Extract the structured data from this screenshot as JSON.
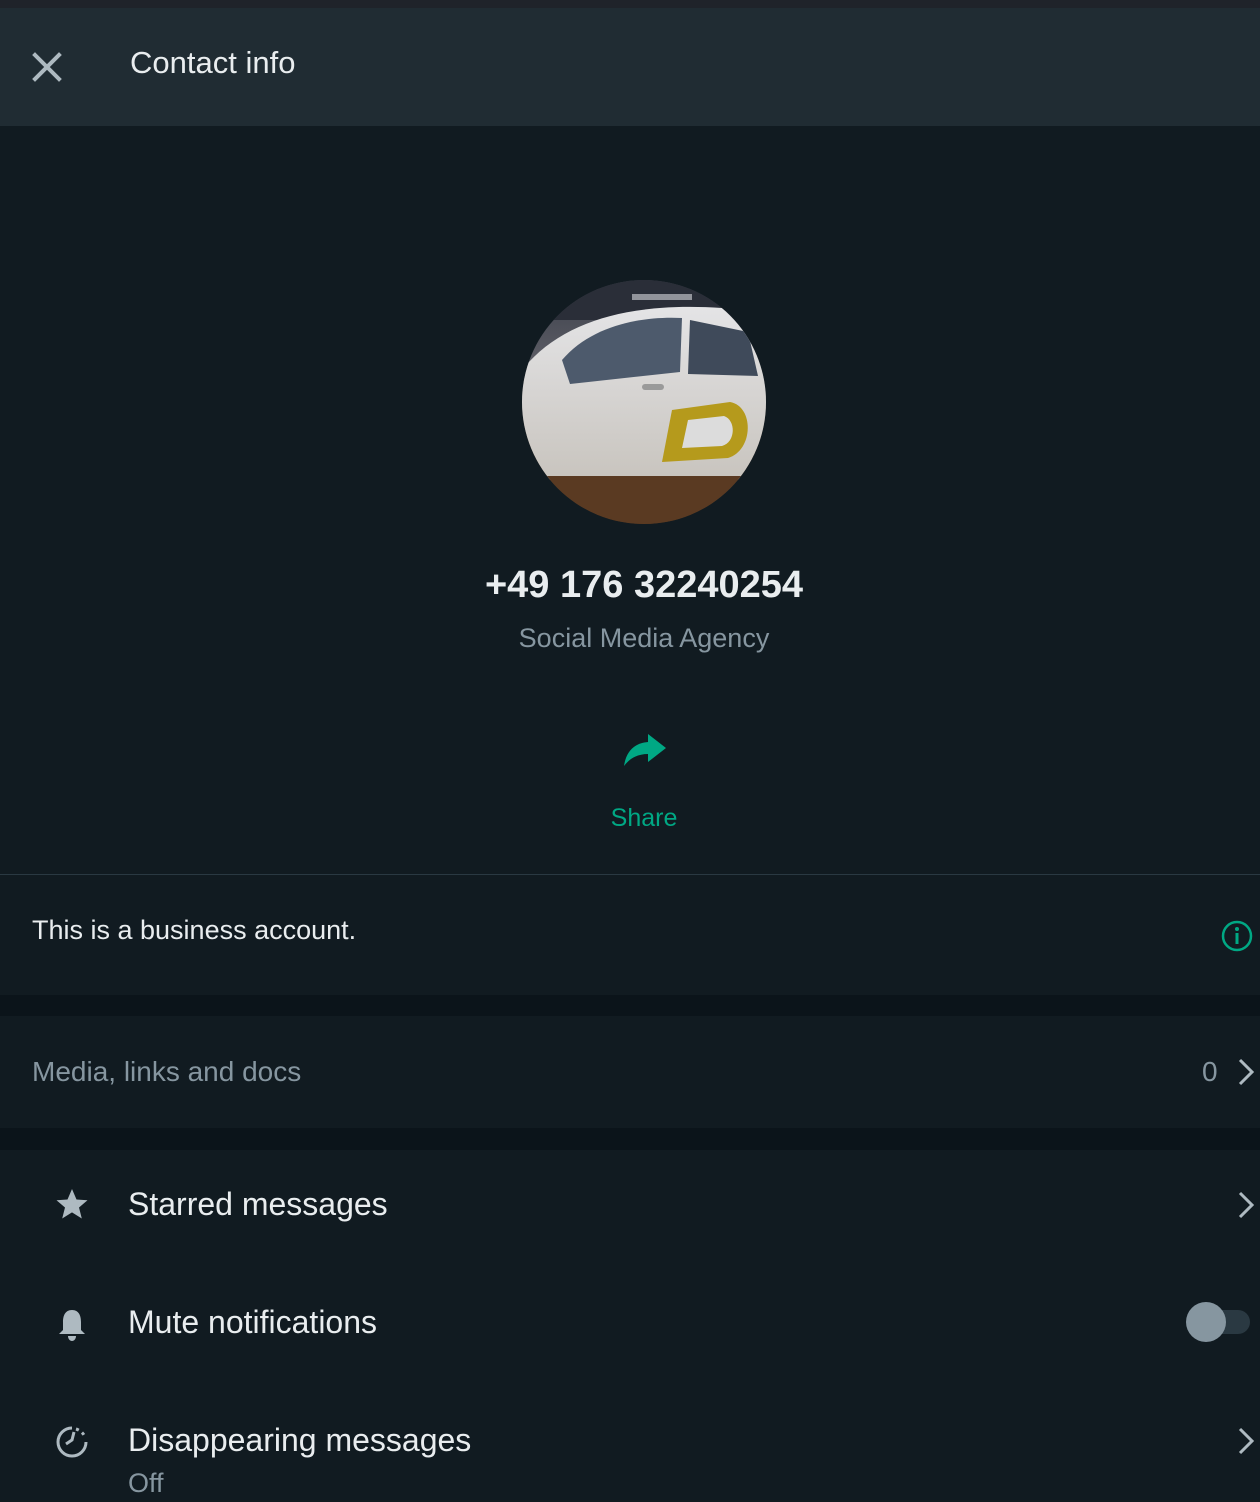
{
  "header": {
    "title": "Contact info",
    "close_icon": "close-icon"
  },
  "profile": {
    "phone": "+49 176 32240254",
    "subtitle": "Social Media Agency",
    "share_label": "Share",
    "share_icon": "share-arrow-icon"
  },
  "business": {
    "text": "This is a business account.",
    "info_icon": "info-icon"
  },
  "media": {
    "label": "Media, links and docs",
    "count": "0"
  },
  "rows": [
    {
      "label": "Starred messages",
      "icon": "star-icon"
    },
    {
      "label": "Mute notifications",
      "icon": "bell-icon",
      "toggle_on": false
    },
    {
      "label": "Disappearing messages",
      "sub": "Off",
      "icon": "timer-icon"
    }
  ],
  "colors": {
    "background": "#111b21",
    "header": "#202c33",
    "accent": "#00a884",
    "secondary_text": "#8696a0",
    "primary_text": "#e9edef"
  }
}
